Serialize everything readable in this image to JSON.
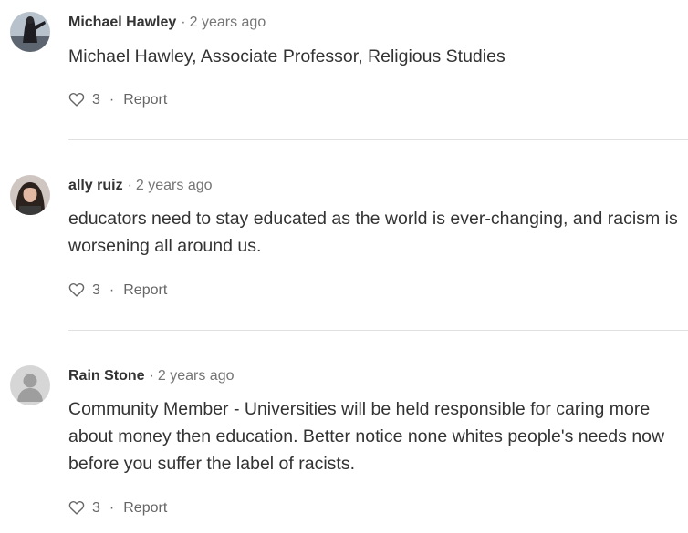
{
  "comments": [
    {
      "author": "Michael Hawley",
      "separator": "·",
      "time": "2 years ago",
      "text": "Michael Hawley, Associate Professor, Religious Studies",
      "likes": "3",
      "action_separator": "·",
      "report_label": "Report"
    },
    {
      "author": "ally ruiz",
      "separator": "·",
      "time": "2 years ago",
      "text": "educators need to stay educated as the world is ever-changing, and racism is worsening all around us.",
      "likes": "3",
      "action_separator": "·",
      "report_label": "Report"
    },
    {
      "author": "Rain Stone",
      "separator": "·",
      "time": "2 years ago",
      "text": "Community Member - Universities will be held responsible for caring more about money then education. Better notice none whites people's needs now before you suffer the label of racists.",
      "likes": "3",
      "action_separator": "·",
      "report_label": "Report"
    }
  ],
  "icons": {
    "like": "heart-outline-icon",
    "avatar_default": "default-user-avatar-icon"
  },
  "colors": {
    "text": "#333333",
    "muted": "#757575",
    "divider": "#e0e0e0"
  }
}
